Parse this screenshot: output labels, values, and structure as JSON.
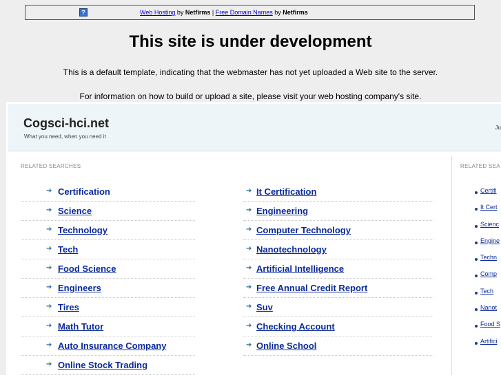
{
  "topbar": {
    "link1": "Web Hosting",
    "by1": " by ",
    "brand1": "Netfirms",
    "sep": " | ",
    "link2": "Free Domain Names",
    "by2": " by ",
    "brand2": "Netfirms"
  },
  "heading": "This site is under development",
  "line1": "This is a default template, indicating that the webmaster has not yet uploaded a Web site to the server.",
  "line2": "For information on how to build or upload a site, please visit your web hosting company's site.",
  "parked": {
    "site_name": "Cogsci-hci.net",
    "tagline": "What you need, when you need it",
    "header_right": "Ju",
    "related_label": "RELATED SEARCHES",
    "related_label_right": "RELATED SEA",
    "left_links": [
      "Certification",
      "Science",
      "Technology",
      "Tech",
      "Food Science",
      "Engineers",
      "Tires",
      "Math Tutor",
      "Auto Insurance Company",
      "Online Stock Trading"
    ],
    "mid_links": [
      "It Certification",
      "Engineering",
      "Computer Technology",
      "Nanotechnology",
      "Artificial Intelligence",
      "Free Annual Credit Report",
      "Suv",
      "Checking Account",
      "Online School"
    ],
    "right_links": [
      "Certifi",
      "It Cert",
      "Scienc",
      "Engine",
      "Techn",
      "Comp",
      "Tech",
      "Nanot",
      "Food S",
      "Artifici"
    ]
  }
}
